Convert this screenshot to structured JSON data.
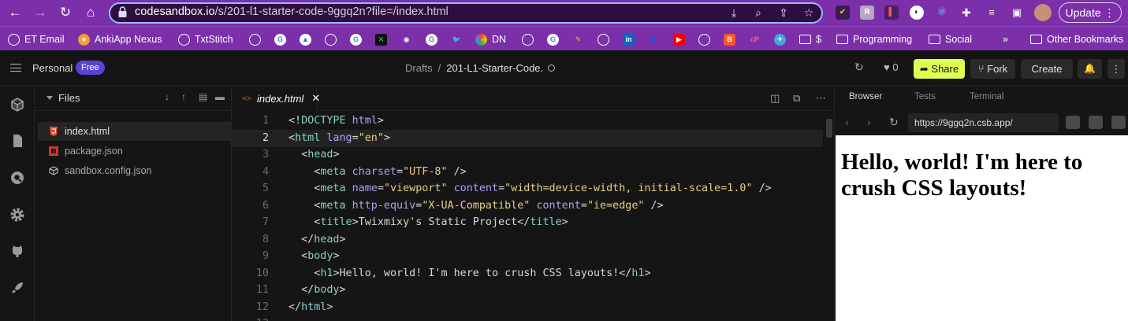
{
  "browser": {
    "url_host": "codesandbox.io",
    "url_path": "/s/201-l1-starter-code-9ggq2n?file=/index.html",
    "update_label": "Update"
  },
  "bookmarks": [
    {
      "label": "ET Email"
    },
    {
      "label": "AnkiApp Nexus"
    },
    {
      "label": "TxtStitch"
    },
    {
      "label": "DN"
    },
    {
      "label": "$"
    },
    {
      "label": "Programming"
    },
    {
      "label": "Social"
    },
    {
      "label": "»"
    },
    {
      "label": "Other Bookmarks"
    }
  ],
  "header": {
    "workspace": "Personal",
    "plan_badge": "Free",
    "breadcrumb_root": "Drafts",
    "breadcrumb_sep": "/",
    "breadcrumb_current": "201-L1-Starter-Code.",
    "likes": "0",
    "share_label": "Share",
    "fork_label": "Fork",
    "create_label": "Create"
  },
  "files": {
    "title": "Files",
    "items": [
      {
        "name": "index.html",
        "icon": "html5-icon",
        "active": true
      },
      {
        "name": "package.json",
        "icon": "npm-icon",
        "active": false
      },
      {
        "name": "sandbox.config.json",
        "icon": "cube-icon",
        "active": false
      }
    ]
  },
  "editor": {
    "tab_icon": "<>",
    "tab_label": "index.html",
    "current_line": 2,
    "lines": [
      {
        "n": "1",
        "tokens": [
          [
            "pn",
            "<!"
          ],
          [
            "tg",
            "DOCTYPE"
          ],
          [
            "pn",
            " "
          ],
          [
            "at",
            "html"
          ],
          [
            "pn",
            ">"
          ]
        ]
      },
      {
        "n": "2",
        "tokens": [
          [
            "pn",
            "<"
          ],
          [
            "tg",
            "html"
          ],
          [
            "pn",
            " "
          ],
          [
            "at",
            "lang"
          ],
          [
            "pn",
            "="
          ],
          [
            "st",
            "\"en\""
          ],
          [
            "pn",
            ">"
          ]
        ]
      },
      {
        "n": "3",
        "tokens": [
          [
            "pn",
            "  <"
          ],
          [
            "tg",
            "head"
          ],
          [
            "pn",
            ">"
          ]
        ]
      },
      {
        "n": "4",
        "tokens": [
          [
            "pn",
            "    <"
          ],
          [
            "tg",
            "meta"
          ],
          [
            "pn",
            " "
          ],
          [
            "at",
            "charset"
          ],
          [
            "pn",
            "="
          ],
          [
            "st",
            "\"UTF-8\""
          ],
          [
            "pn",
            " />"
          ]
        ]
      },
      {
        "n": "5",
        "tokens": [
          [
            "pn",
            "    <"
          ],
          [
            "tg",
            "meta"
          ],
          [
            "pn",
            " "
          ],
          [
            "at",
            "name"
          ],
          [
            "pn",
            "="
          ],
          [
            "st",
            "\"viewport\""
          ],
          [
            "pn",
            " "
          ],
          [
            "at",
            "content"
          ],
          [
            "pn",
            "="
          ],
          [
            "st",
            "\"width=device-width, initial-scale=1.0\""
          ],
          [
            "pn",
            " />"
          ]
        ]
      },
      {
        "n": "6",
        "tokens": [
          [
            "pn",
            "    <"
          ],
          [
            "tg",
            "meta"
          ],
          [
            "pn",
            " "
          ],
          [
            "at",
            "http-equiv"
          ],
          [
            "pn",
            "="
          ],
          [
            "st",
            "\"X-UA-Compatible\""
          ],
          [
            "pn",
            " "
          ],
          [
            "at",
            "content"
          ],
          [
            "pn",
            "="
          ],
          [
            "st",
            "\"ie=edge\""
          ],
          [
            "pn",
            " />"
          ]
        ]
      },
      {
        "n": "7",
        "tokens": [
          [
            "pn",
            "    <"
          ],
          [
            "tg",
            "title"
          ],
          [
            "pn",
            ">Twixmixy's Static Project</"
          ],
          [
            "tg",
            "title"
          ],
          [
            "pn",
            ">"
          ]
        ]
      },
      {
        "n": "8",
        "tokens": [
          [
            "pn",
            "  </"
          ],
          [
            "tg",
            "head"
          ],
          [
            "pn",
            ">"
          ]
        ]
      },
      {
        "n": "9",
        "tokens": [
          [
            "pn",
            "  <"
          ],
          [
            "tg",
            "body"
          ],
          [
            "pn",
            ">"
          ]
        ]
      },
      {
        "n": "10",
        "tokens": [
          [
            "pn",
            "    <"
          ],
          [
            "tg",
            "h1"
          ],
          [
            "pn",
            ">Hello, world! I'm here to crush CSS layouts!</"
          ],
          [
            "tg",
            "h1"
          ],
          [
            "pn",
            ">"
          ]
        ]
      },
      {
        "n": "11",
        "tokens": [
          [
            "pn",
            "  </"
          ],
          [
            "tg",
            "body"
          ],
          [
            "pn",
            ">"
          ]
        ]
      },
      {
        "n": "12",
        "tokens": [
          [
            "pn",
            "</"
          ],
          [
            "tg",
            "html"
          ],
          [
            "pn",
            ">"
          ]
        ]
      },
      {
        "n": "13",
        "tokens": []
      }
    ]
  },
  "preview": {
    "tabs": [
      "Browser",
      "Tests",
      "Terminal"
    ],
    "url": "https://9ggq2n.csb.app/",
    "heading": "Hello, world! I'm here to crush CSS layouts!"
  },
  "colors": {
    "chrome_purple": "#7b2fa8",
    "share_yellow": "#dcff50",
    "badge_purple": "#5b42d6"
  }
}
